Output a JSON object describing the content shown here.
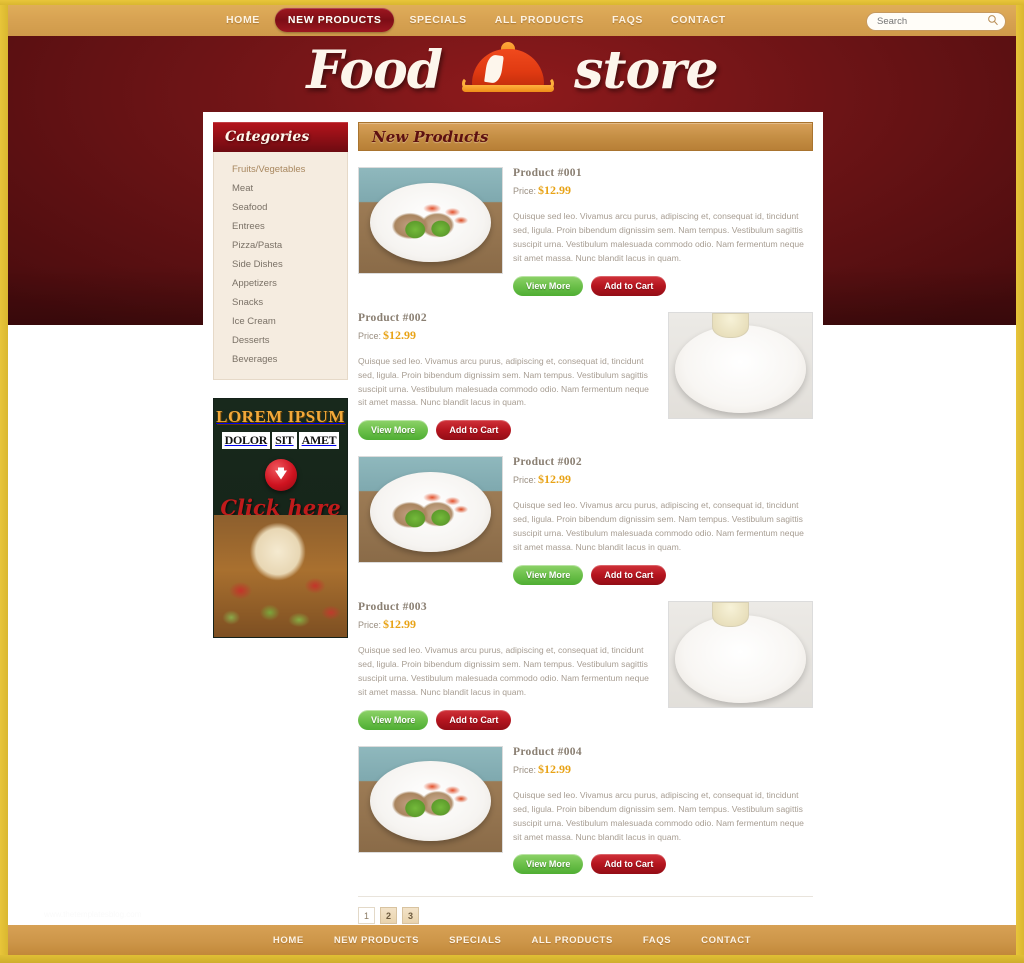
{
  "topnav": {
    "items": [
      {
        "label": "HOME",
        "active": false
      },
      {
        "label": "NEW PRODUCTS",
        "active": true
      },
      {
        "label": "SPECIALS",
        "active": false
      },
      {
        "label": "ALL PRODUCTS",
        "active": false
      },
      {
        "label": "FAQS",
        "active": false
      },
      {
        "label": "CONTACT",
        "active": false
      }
    ]
  },
  "search": {
    "placeholder": "Search",
    "value": "",
    "icon": "search-icon"
  },
  "logo": {
    "word1": "Food",
    "word2": "store",
    "icon": "food-cloche-icon"
  },
  "sidebar": {
    "categories_title": "Categories",
    "categories": [
      "Fruits/Vegetables",
      "Meat",
      "Seafood",
      "Entrees",
      "Pizza/Pasta",
      "Side Dishes",
      "Appetizers",
      "Snacks",
      "Ice Cream",
      "Desserts",
      "Beverages"
    ],
    "banner": {
      "line1": "LOREM IPSUM",
      "word1": "DOLOR",
      "word2": "SIT",
      "word3": "AMET",
      "cta": "Click here",
      "arrow_icon": "down-arrow-icon",
      "image": "pizza-photo"
    }
  },
  "main": {
    "section_title": "New Products",
    "description": "Quisque sed leo. Vivamus arcu purus, adipiscing et, consequat id, tincidunt sed, ligula. Proin bibendum dignissim sem. Nam tempus. Vestibulum sagittis suscipit urna. Vestibulum malesuada commodo odio. Nam fermentum neque sit amet massa. Nunc blandit lacus in quam.",
    "price_label": "Price:",
    "view_label": "View More",
    "cart_label": "Add to Cart",
    "products": [
      {
        "title": "Product #001",
        "price": "$12.99",
        "image": "stuffed-chicken-plate",
        "layout": "image-left"
      },
      {
        "title": "Product #002",
        "price": "$12.99",
        "image": "cutlets-beans-plate",
        "layout": "image-right"
      },
      {
        "title": "Product #002",
        "price": "$12.99",
        "image": "stuffed-chicken-plate",
        "layout": "image-left"
      },
      {
        "title": "Product #003",
        "price": "$12.99",
        "image": "cutlets-beans-plate",
        "layout": "image-right"
      },
      {
        "title": "Product #004",
        "price": "$12.99",
        "image": "stuffed-chicken-plate",
        "layout": "image-left"
      }
    ],
    "pagination": [
      {
        "label": "1",
        "active": false
      },
      {
        "label": "2",
        "active": true
      },
      {
        "label": "3",
        "active": true
      }
    ]
  },
  "watermark": "www.thetemplatesblog.com",
  "footer": {
    "items": [
      "HOME",
      "NEW PRODUCTS",
      "SPECIALS",
      "ALL PRODUCTS",
      "FAQS",
      "CONTACT"
    ]
  },
  "colors": {
    "gold_frame": "#e0bf35",
    "nav_bar": "#d8a353",
    "header_red": "#6d1416",
    "active_pill": "#8e0f16",
    "price_orange": "#e8a317",
    "btn_green": "#6cc04a",
    "btn_red": "#b5151f"
  }
}
